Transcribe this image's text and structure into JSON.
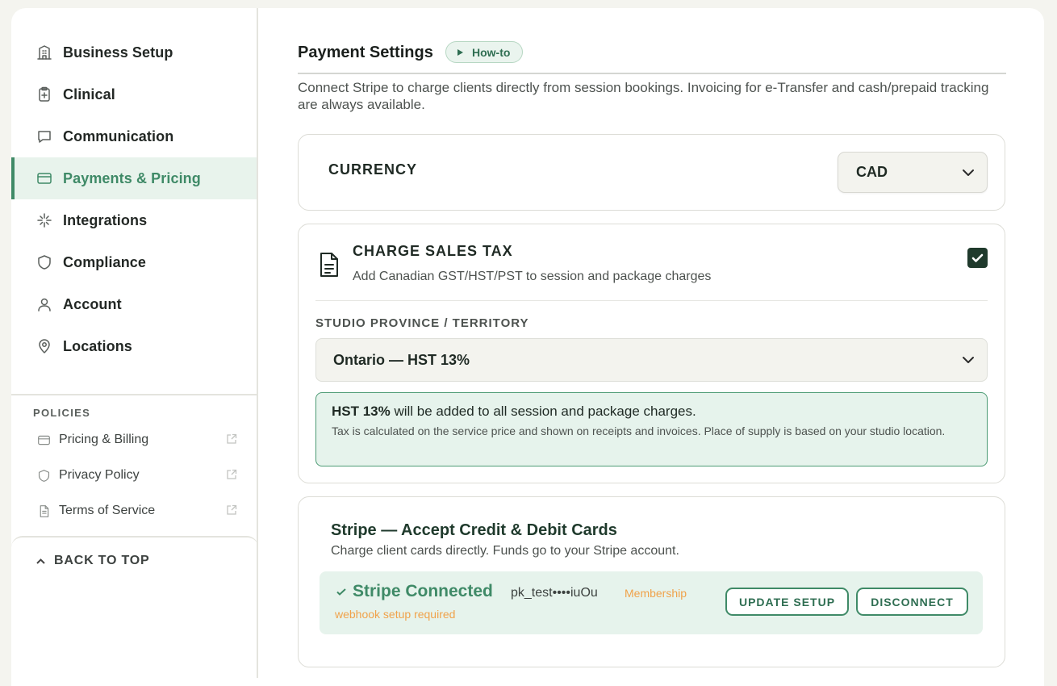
{
  "sidebar": {
    "items": [
      {
        "label": "Business Setup",
        "icon": "building-icon"
      },
      {
        "label": "Clinical",
        "icon": "clipboard-icon"
      },
      {
        "label": "Communication",
        "icon": "chat-icon"
      },
      {
        "label": "Payments & Pricing",
        "icon": "credit-card-icon"
      },
      {
        "label": "Integrations",
        "icon": "plug-icon"
      },
      {
        "label": "Compliance",
        "icon": "shield-icon"
      },
      {
        "label": "Account",
        "icon": "user-icon"
      },
      {
        "label": "Locations",
        "icon": "map-pin-icon"
      }
    ],
    "active_item": "Payments & Pricing",
    "policies_title": "POLICIES",
    "policies": [
      {
        "label": "Pricing & Billing",
        "icon": "credit-card-icon"
      },
      {
        "label": "Privacy Policy",
        "icon": "shield-icon"
      },
      {
        "label": "Terms of Service",
        "icon": "document-icon"
      }
    ],
    "back_to_top": "BACK TO TOP"
  },
  "header": {
    "title": "Payment Settings",
    "howto_label": "How-to",
    "description": "Connect Stripe to charge clients directly from session bookings. Invoicing for e-Transfer and cash/prepaid tracking are always available."
  },
  "currency": {
    "label": "CURRENCY",
    "selected": "CAD"
  },
  "sales_tax": {
    "title": "CHARGE SALES TAX",
    "subtitle": "Add Canadian GST/HST/PST to session and package charges",
    "checked": true,
    "province_label": "STUDIO PROVINCE / TERRITORY",
    "province_selected": "Ontario — HST 13%",
    "notice_rate": "HST 13%",
    "notice_text": " will be added to all session and package charges.",
    "notice_detail": "Tax is calculated on the service price and shown on receipts and invoices. Place of supply is based on your studio location."
  },
  "stripe": {
    "title": "Stripe — Accept Credit & Debit Cards",
    "subtitle": "Charge client cards directly. Funds go to your Stripe account.",
    "status": "Stripe Connected",
    "key": "pk_test••••iuOu",
    "warning_line1": "Membership",
    "warning_line2": "webhook setup required",
    "update_label": "UPDATE SETUP",
    "disconnect_label": "DISCONNECT"
  },
  "colors": {
    "accent": "#3f8a67",
    "accent_bg": "#e8f3ec",
    "warning": "#f0a24a",
    "checkbox": "#1f3a2c"
  }
}
